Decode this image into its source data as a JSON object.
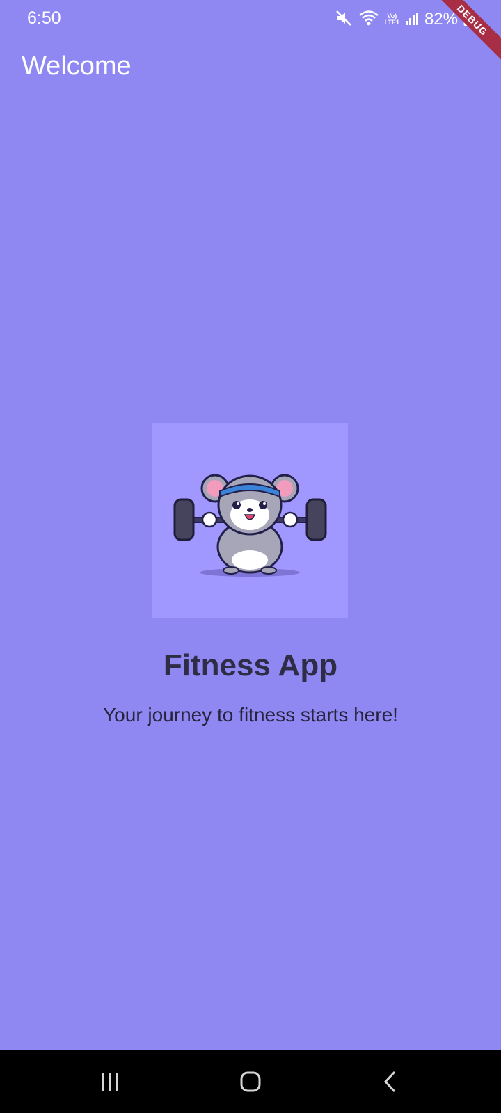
{
  "status_bar": {
    "time": "6:50",
    "battery_percent": "82%",
    "volte_label_line1": "Vo)",
    "volte_label_line2": "LTE1",
    "icons": [
      "mute-icon",
      "wifi-icon",
      "volte-icon",
      "signal-icon",
      "battery-icon"
    ]
  },
  "debug_banner": {
    "label": "DEBUG"
  },
  "app_bar": {
    "title": "Welcome"
  },
  "hero": {
    "image_alt": "cartoon mouse lifting barbell",
    "title": "Fitness App",
    "subtitle": "Your journey to fitness starts here!"
  },
  "navigation": {
    "buttons": [
      "recent-apps",
      "home",
      "back"
    ]
  },
  "colors": {
    "background": "#8f88f2",
    "image_background": "#a198ff",
    "title_text": "#2f2c45",
    "nav_bar": "#000000",
    "debug_banner": "#a72e45"
  }
}
